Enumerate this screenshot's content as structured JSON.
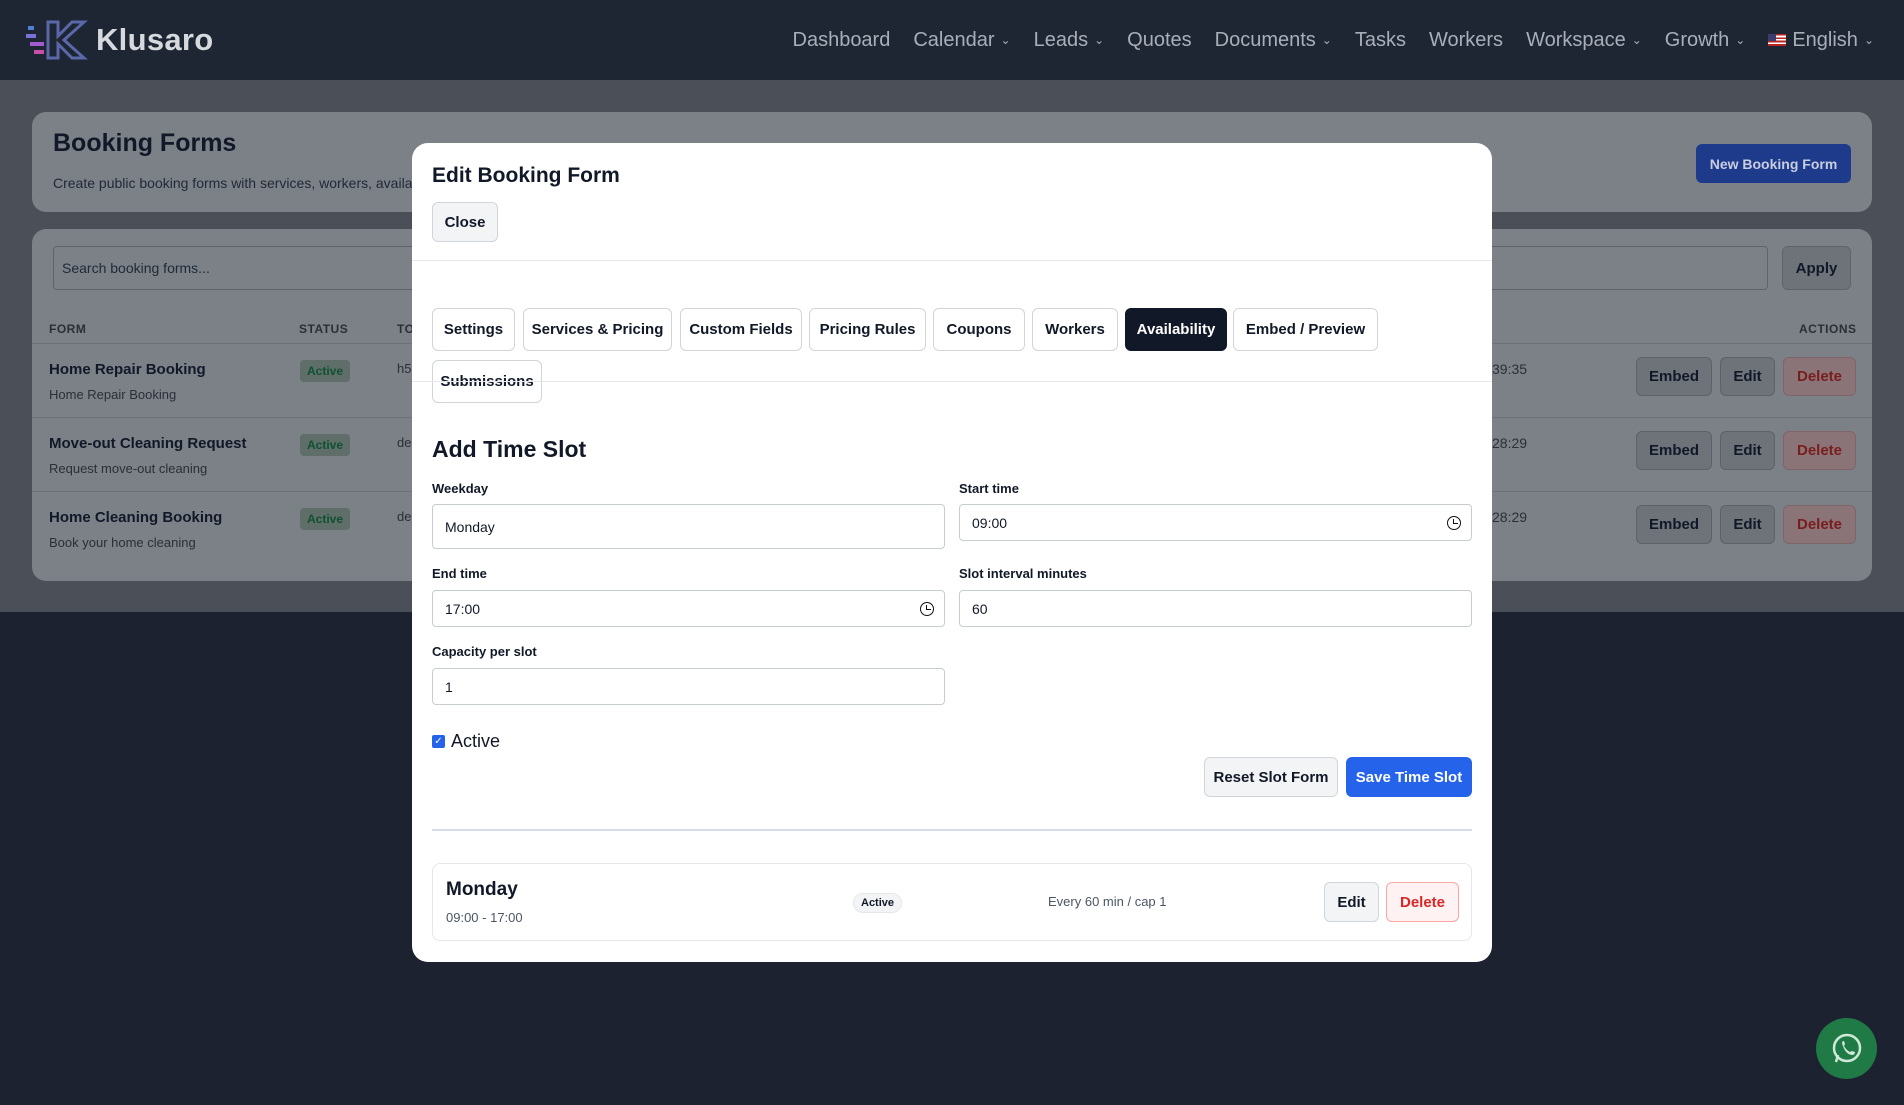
{
  "app": {
    "brand": "Klusaro"
  },
  "nav": {
    "items": [
      {
        "label": "Dashboard",
        "dropdown": false
      },
      {
        "label": "Calendar",
        "dropdown": true
      },
      {
        "label": "Leads",
        "dropdown": true
      },
      {
        "label": "Quotes",
        "dropdown": false
      },
      {
        "label": "Documents",
        "dropdown": true
      },
      {
        "label": "Tasks",
        "dropdown": false
      },
      {
        "label": "Workers",
        "dropdown": false
      },
      {
        "label": "Workspace",
        "dropdown": true
      },
      {
        "label": "Growth",
        "dropdown": true
      }
    ],
    "language": "English"
  },
  "page": {
    "title": "Booking Forms",
    "subtitle": "Create public booking forms with services, workers, availabili",
    "new_button": "New Booking Form",
    "search_placeholder": "Search booking forms...",
    "apply_button": "Apply",
    "columns": {
      "form": "FORM",
      "status": "STATUS",
      "token": "TO",
      "actions": "ACTIONS"
    },
    "rows": [
      {
        "name": "Home Repair Booking",
        "sub": "Home Repair Booking",
        "status": "Active",
        "token": "h5",
        "date": "39:35"
      },
      {
        "name": "Move-out Cleaning Request",
        "sub": "Request move-out cleaning",
        "status": "Active",
        "token": "de",
        "date": "28:29"
      },
      {
        "name": "Home Cleaning Booking",
        "sub": "Book your home cleaning",
        "status": "Active",
        "token": "de",
        "date": "28:29"
      }
    ],
    "row_actions": {
      "embed": "Embed",
      "edit": "Edit",
      "delete": "Delete"
    }
  },
  "modal": {
    "title": "Edit Booking Form",
    "close_label": "Close",
    "tabs": [
      {
        "label": "Settings",
        "active": false
      },
      {
        "label": "Services & Pricing",
        "active": false
      },
      {
        "label": "Custom Fields",
        "active": false
      },
      {
        "label": "Pricing Rules",
        "active": false
      },
      {
        "label": "Coupons",
        "active": false
      },
      {
        "label": "Workers",
        "active": false
      },
      {
        "label": "Availability",
        "active": true
      },
      {
        "label": "Embed / Preview",
        "active": false
      },
      {
        "label": "Submissions",
        "active": false
      }
    ],
    "section_title": "Add Time Slot",
    "form": {
      "weekday_label": "Weekday",
      "weekday_value": "Monday",
      "start_label": "Start time",
      "start_value": "09:00",
      "end_label": "End time",
      "end_value": "17:00",
      "interval_label": "Slot interval minutes",
      "interval_value": "60",
      "capacity_label": "Capacity per slot",
      "capacity_value": "1",
      "active_label": "Active",
      "active_checked": true
    },
    "reset_button": "Reset Slot Form",
    "save_button": "Save Time Slot",
    "slots": [
      {
        "day": "Monday",
        "time": "09:00 - 17:00",
        "status": "Active",
        "info": "Every 60 min / cap 1",
        "edit": "Edit",
        "delete": "Delete"
      }
    ]
  },
  "colors": {
    "primary": "#2563eb",
    "active_tab": "#111827",
    "danger": "#dc2626",
    "overlay": "#1c2230"
  }
}
